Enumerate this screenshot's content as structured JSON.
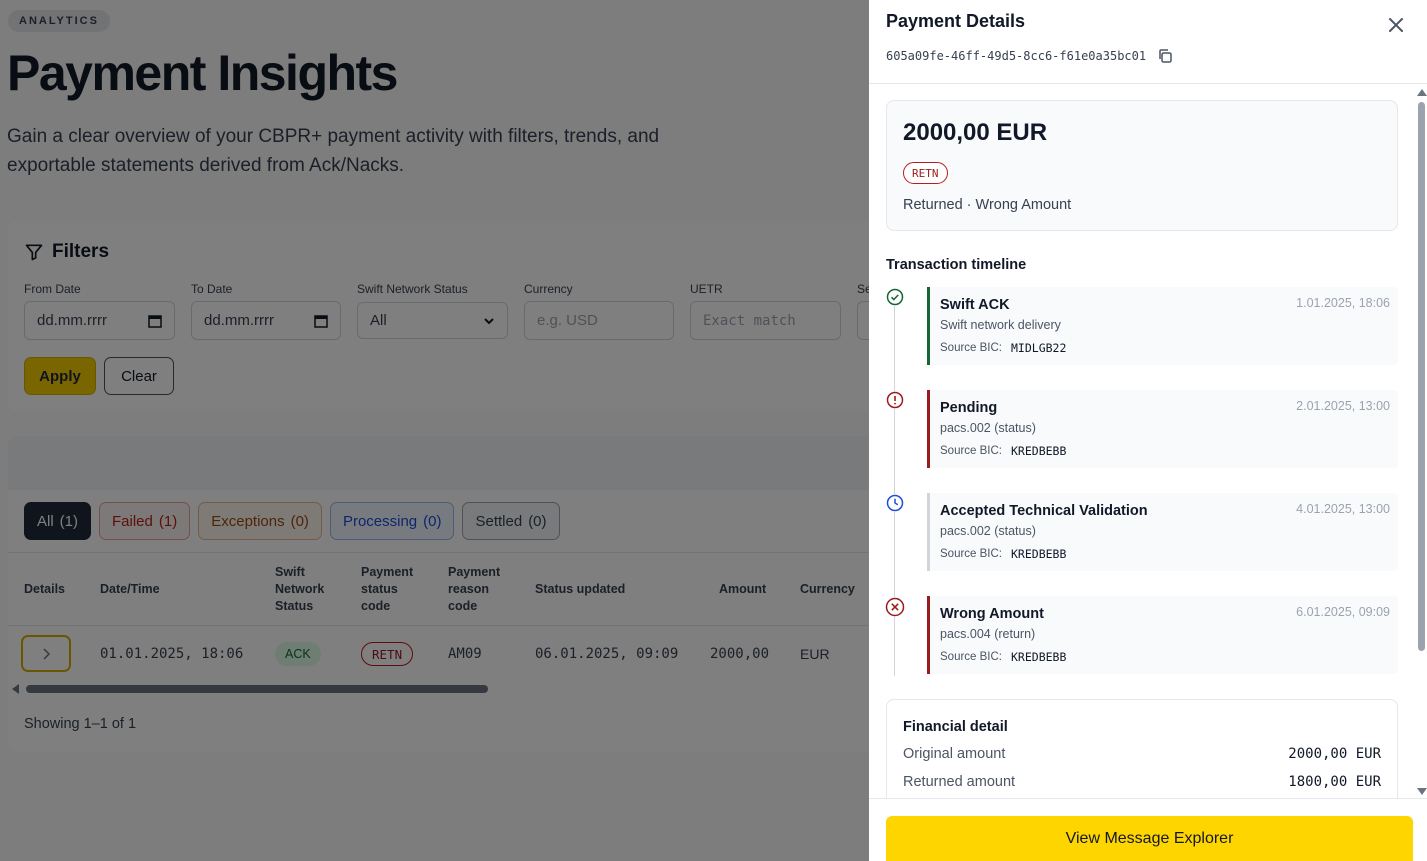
{
  "page": {
    "badge": "ANALYTICS",
    "title": "Payment Insights",
    "subtitle": "Gain a clear overview of your CBPR+ payment activity with filters, trends, and exportable statements derived from Ack/Nacks."
  },
  "filters": {
    "heading": "Filters",
    "from_date_label": "From Date",
    "from_date_value": "dd.mm.rrrr",
    "to_date_label": "To Date",
    "to_date_value": "dd.mm.rrrr",
    "status_label": "Swift Network Status",
    "status_value": "All",
    "currency_label": "Currency",
    "currency_placeholder": "e.g. USD",
    "uetr_label": "UETR",
    "uetr_placeholder": "Exact match",
    "cut_label": "Se",
    "apply_label": "Apply",
    "clear_label": "Clear"
  },
  "tabs": [
    {
      "label": "All",
      "count": "(1)"
    },
    {
      "label": "Failed",
      "count": "(1)"
    },
    {
      "label": "Exceptions",
      "count": "(0)"
    },
    {
      "label": "Processing",
      "count": "(0)"
    },
    {
      "label": "Settled",
      "count": "(0)"
    }
  ],
  "table": {
    "headers": {
      "details": "Details",
      "datetime": "Date/Time",
      "swift_status_1": "Swift",
      "swift_status_2": "Network",
      "swift_status_3": "Status",
      "pay_status_1": "Payment",
      "pay_status_2": "status",
      "pay_status_3": "code",
      "reason_1": "Payment",
      "reason_2": "reason",
      "reason_3": "code",
      "updated": "Status updated",
      "amount": "Amount",
      "currency": "Currency"
    },
    "row": {
      "datetime": "01.01.2025, 18:06",
      "swift_status": "ACK",
      "status_code": "RETN",
      "reason_code": "AM09",
      "updated": "06.01.2025, 09:09",
      "amount": "2000,00",
      "currency": "EUR"
    },
    "showing": "Showing 1–1 of 1"
  },
  "drawer": {
    "title": "Payment Details",
    "uetr": "605a09fe-46ff-49d5-8cc6-f61e0a35bc01",
    "amount": "2000,00 EUR",
    "status_badge": "RETN",
    "status_text": "Returned · Wrong Amount",
    "timeline_title": "Transaction timeline",
    "bic_label": "Source BIC:",
    "timeline": [
      {
        "name": "Swift ACK",
        "time": "1.01.2025, 18:06",
        "desc": "Swift network delivery",
        "bic": "MIDLGB22",
        "icon": "check-circle-icon",
        "color": "#166534"
      },
      {
        "name": "Pending",
        "time": "2.01.2025, 13:00",
        "desc": "pacs.002 (status)",
        "bic": "KREDBEBB",
        "icon": "alert-circle-icon",
        "color": "#991b1b"
      },
      {
        "name": "Accepted Technical Validation",
        "time": "4.01.2025, 13:00",
        "desc": "pacs.002 (status)",
        "bic": "KREDBEBB",
        "icon": "clock-icon",
        "color": "#d1d5db"
      },
      {
        "name": "Wrong Amount",
        "time": "6.01.2025, 09:09",
        "desc": "pacs.004 (return)",
        "bic": "KREDBEBB",
        "icon": "x-circle-icon",
        "color": "#991b1b"
      }
    ],
    "financial": {
      "title": "Financial detail",
      "original_label": "Original amount",
      "original_value": "2000,00 EUR",
      "returned_label": "Returned amount",
      "returned_value": "1800,00 EUR"
    },
    "footer_button": "View Message Explorer"
  }
}
